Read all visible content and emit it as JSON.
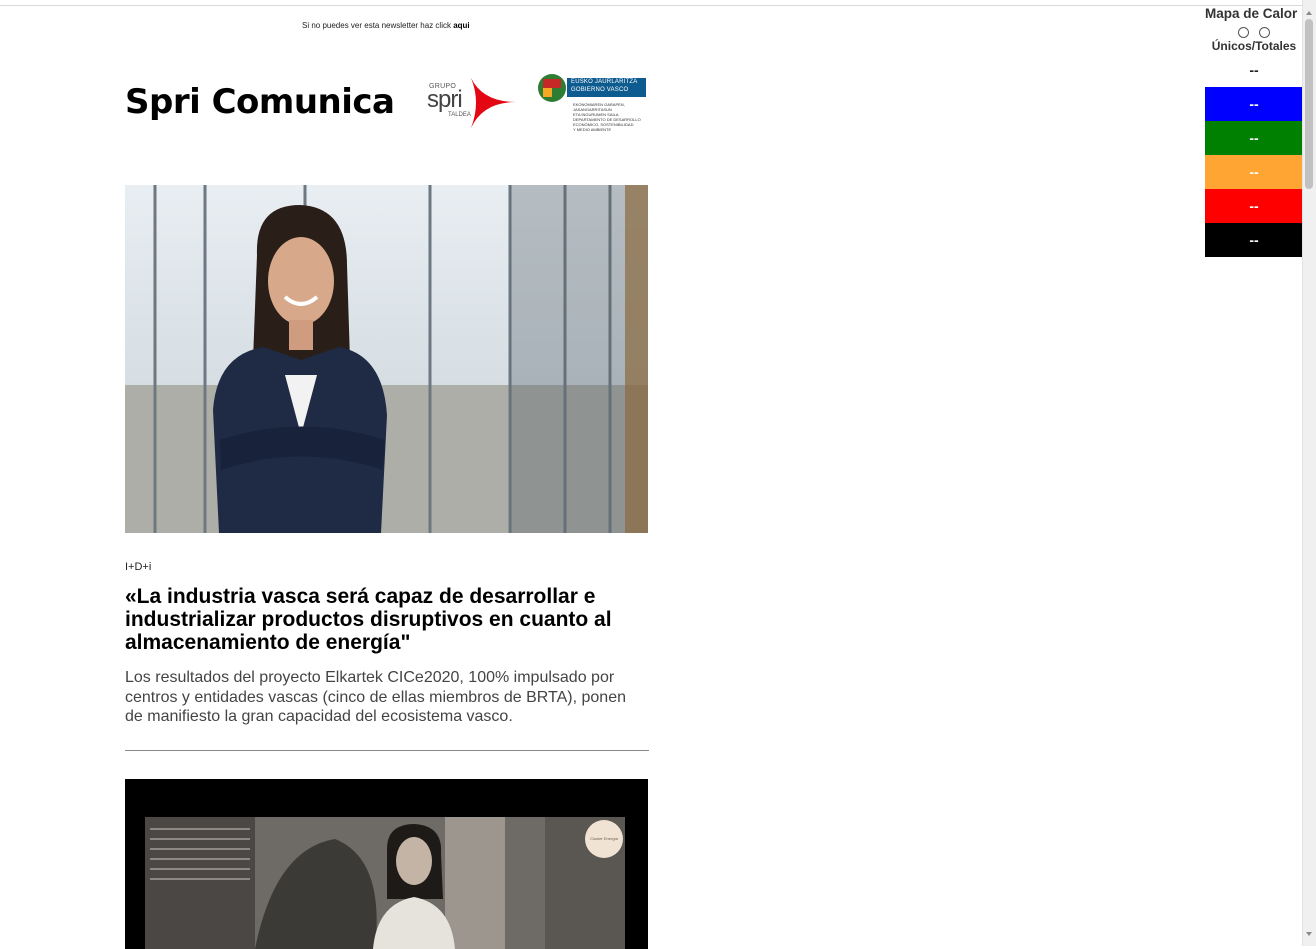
{
  "preheader": {
    "text": "Si no puedes ver esta newsletter haz click ",
    "link": "aqui"
  },
  "masthead": {
    "title": "Spri Comunica"
  },
  "spri_logo": {
    "grupo": "GRUPO",
    "word": "spri",
    "taldea": "TALDEA"
  },
  "gov_logo": {
    "line1": "EUSKO JAURLARITZA",
    "line2": "GOBIERNO VASCO",
    "dept_lines": [
      "EKONOMIAREN GARAPEN,",
      "JASANGARRITASUN",
      "ETA INGURUMEN SAILA",
      "DEPARTAMENTO DE DESARROLLO",
      "ECONÓMICO, SOSTENIBILIDAD",
      "Y MEDIO AMBIENTE"
    ]
  },
  "article": {
    "category": "I+D+i",
    "headline": "«La industria vasca será capaz de desarrollar e industrializar productos disruptivos en cuanto al almacenamiento de energía\"",
    "summary": "Los resultados del proyecto Elkartek CICe2020, 100% impulsado por centros y entidades vascas (cinco de ellas miembros de BRTA), ponen de manifiesto la gran capacidad del ecosistema vasco."
  },
  "video": {
    "badge": "Cluster Energía"
  },
  "heatmap": {
    "title": "Mapa de Calor",
    "mode_label": "Únicos/Totales",
    "rows": [
      {
        "value": "--",
        "color": "#ffffff"
      },
      {
        "value": "--",
        "color": "#0000ff"
      },
      {
        "value": "--",
        "color": "#008000"
      },
      {
        "value": "--",
        "color": "#ffa533"
      },
      {
        "value": "--",
        "color": "#ff0000"
      },
      {
        "value": "--",
        "color": "#000000"
      }
    ]
  },
  "colors": {
    "spri_red": "#e30613",
    "gov_blue": "#0e5b8f"
  }
}
